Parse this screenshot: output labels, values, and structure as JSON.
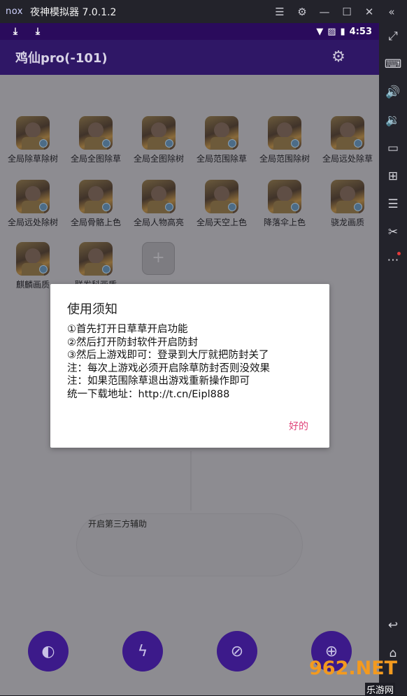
{
  "window": {
    "logo": "nox",
    "title": "夜神模拟器 7.0.1.2",
    "controls": [
      "menu-icon",
      "gear-icon",
      "minimize-icon",
      "maximize-icon",
      "close-icon",
      "collapse-icon"
    ]
  },
  "statusbar": {
    "time": "4:53",
    "icons": [
      "download-icon",
      "download-icon",
      "wifi-icon",
      "no-sim-icon",
      "battery-icon"
    ]
  },
  "app": {
    "title": "鸡仙pro(-101)",
    "settings_icon": "gear-icon"
  },
  "tiles": [
    {
      "label": "全局除草除树"
    },
    {
      "label": "全局全图除草"
    },
    {
      "label": "全局全图除树"
    },
    {
      "label": "全局范围除草"
    },
    {
      "label": "全局范围除树"
    },
    {
      "label": "全局远处除草"
    },
    {
      "label": "全局远处除树"
    },
    {
      "label": "全局骨骼上色"
    },
    {
      "label": "全局人物高亮"
    },
    {
      "label": "全局天空上色"
    },
    {
      "label": "降落伞上色"
    },
    {
      "label": "骁龙画质"
    },
    {
      "label": "麒麟画质"
    },
    {
      "label": "联发科画质"
    }
  ],
  "add_tile": "+",
  "background_text": "开启第三方辅助",
  "dialog": {
    "title": "使用须知",
    "lines": [
      "①首先打开日草草开启功能",
      "②然后打开防封软件开启防封",
      "③然后上游戏即可：登录到大厅就把防封关了",
      "注：每次上游戏必须开启除草防封否则没效果",
      "注：如果范围除草退出游戏重新操作即可",
      "统一下载地址：http://t.cn/Eipl888"
    ],
    "ok_label": "好的"
  },
  "bottom_buttons": [
    "contrast-icon",
    "lightning-icon",
    "block-icon",
    "globe-icon"
  ],
  "sidebar_icons": [
    "fullscreen-icon",
    "keyboard-icon",
    "volume-up-icon",
    "volume-down-icon",
    "screen-icon",
    "apk-install-icon",
    "multi-instance-icon",
    "screenshot-scissors-icon",
    "more-icon",
    "back-icon",
    "home-icon"
  ],
  "watermark": {
    "top": "962.NET",
    "bottom": "乐游网"
  },
  "colors": {
    "statusbar": "#2a0b5c",
    "appbar": "#2f1766",
    "accent_button": "#3c1a8a",
    "dialog_ok": "#e0457b"
  }
}
